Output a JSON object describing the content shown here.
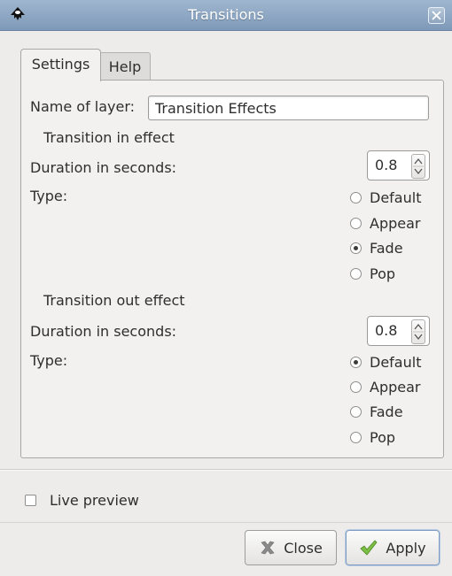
{
  "window": {
    "title": "Transitions"
  },
  "tabs": [
    {
      "label": "Settings",
      "selected": true
    },
    {
      "label": "Help",
      "selected": false
    }
  ],
  "settings": {
    "layer_name_label": "Name of layer:",
    "layer_name_value": "Transition Effects",
    "in": {
      "heading": "Transition in effect",
      "duration_label": "Duration in seconds:",
      "duration_value": "0.8",
      "type_label": "Type:",
      "options": [
        "Default",
        "Appear",
        "Fade",
        "Pop"
      ],
      "selected": "Fade"
    },
    "out": {
      "heading": "Transition out effect",
      "duration_label": "Duration in seconds:",
      "duration_value": "0.8",
      "type_label": "Type:",
      "options": [
        "Default",
        "Appear",
        "Fade",
        "Pop"
      ],
      "selected": "Default"
    }
  },
  "live_preview": {
    "label": "Live preview",
    "checked": false
  },
  "buttons": {
    "close": "Close",
    "apply": "Apply"
  },
  "icons": {
    "app": "inkscape-icon",
    "window_close": "close-icon",
    "close_button": "x-icon",
    "apply_button": "checkmark-icon"
  },
  "colors": {
    "titlebar": "#7e99b8",
    "apply_check": "#6aa83a",
    "close_x": "#8a8a8a"
  }
}
